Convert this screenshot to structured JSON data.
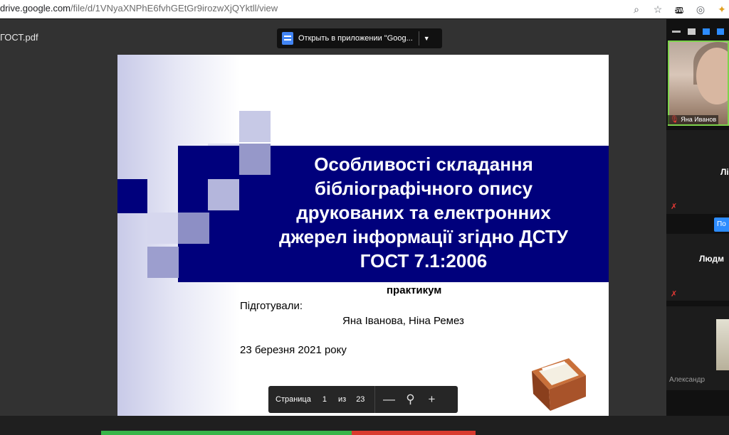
{
  "browser": {
    "url_host": "drive.google.com",
    "url_path": "/file/d/1VNyaXNPhE6fvhGEtGr9irozwXjQYktll/view"
  },
  "viewer": {
    "filename": "ГОСТ.pdf",
    "open_in_app_label": "Открыть в приложении \"Goog...",
    "pager": {
      "page_label": "Страница",
      "current_page": "1",
      "of_label": "из",
      "total_pages": "23"
    }
  },
  "slide": {
    "title_lines": [
      "Особливості складання",
      "бібліографічного опису",
      "друкованих та електронних",
      "джерел інформації згідно ДСТУ",
      "ГОСТ 7.1:2006"
    ],
    "subtitle": "практикум",
    "prepared_label": "Підготували:",
    "authors": "Яна Іванова, Ніна Ремез",
    "date": "23 березня 2021 року"
  },
  "meeting": {
    "participant_1": "Яна Иванов",
    "participant_2": "Лі",
    "participant_3": "Людм",
    "button_label": "По",
    "participant_4": "Александр"
  },
  "colors": {
    "title_band": "#00007c",
    "active_speaker_border": "#7dd34c",
    "muted_mic": "#e53935",
    "meeting_accent": "#2d8cff"
  }
}
